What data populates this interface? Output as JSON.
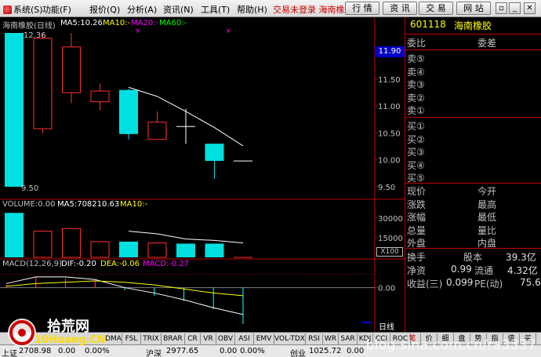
{
  "menu": {
    "items": [
      {
        "label": "系统(S)"
      },
      {
        "label": "功能(F)"
      },
      {
        "label": "报价(Q)"
      },
      {
        "label": "分析(A)"
      },
      {
        "label": "资讯(N)"
      },
      {
        "label": "工具(T)"
      },
      {
        "label": "帮助(H)"
      }
    ],
    "notice": "交易未登录  海南橡胶",
    "buttons": [
      {
        "label": "行 情"
      },
      {
        "label": "资 讯"
      },
      {
        "label": "交 易"
      },
      {
        "label": "网 站"
      }
    ],
    "win_controls": [
      "▫",
      "_",
      "✕"
    ]
  },
  "kline": {
    "stock_name": "海南橡胶(日线)",
    "ma5": "MA5:10.26",
    "ma10": "MA10:-",
    "ma20": "MA20:-",
    "ma60": "MA60:-",
    "high_label": "12.36",
    "low_label": "9.50",
    "current_price_badge": "11.90",
    "y_ticks": [
      "11.50",
      "11.00",
      "10.50",
      "10.00",
      "9.50"
    ]
  },
  "volume": {
    "header": "VOLUME:0.00",
    "ma5": "MA5:708210.63",
    "ma10": "MA10:-",
    "y_ticks": [
      "30000",
      "15000"
    ],
    "unit": "X100"
  },
  "macd": {
    "header": "MACD(12,26,9)",
    "dif": "DIF:-0.20",
    "dea": "DEA:-0.06",
    "macd": "MACD:-0.27",
    "y_ticks": [
      "0.00"
    ],
    "period": "日线"
  },
  "quote_panel": {
    "code": "601118",
    "name": "海南橡胶",
    "weibi": "委比",
    "weicha": "委差",
    "sells": [
      "卖⑤",
      "卖④",
      "卖③",
      "卖②",
      "卖①"
    ],
    "buys": [
      "买①",
      "买②",
      "买③",
      "买④",
      "买⑤"
    ],
    "stats_left": [
      "现价",
      "涨跌",
      "涨幅",
      "总量",
      "外盘"
    ],
    "stats_right": [
      "今开",
      "最高",
      "最低",
      "量比",
      "内盘"
    ],
    "turnover_label": "换手",
    "capital_label": "股本",
    "capital_value": "39.3亿",
    "net_asset_label": "净资",
    "net_asset_value": "0.99",
    "float_label": "流通",
    "float_value": "4.32亿",
    "eps_label": "收益(三)",
    "eps_value": "0.099",
    "pe_label": "PE(动)",
    "pe_value": "75.6"
  },
  "indicator_tabs": [
    "DMA",
    "FSL",
    "TRIX",
    "BRAR",
    "CR",
    "VR",
    "OBV",
    "ASI",
    "EMV",
    "VOL-TDX",
    "RSI",
    "WR",
    "SAR",
    "KDJ",
    "CCI",
    "ROC"
  ],
  "side_tabs": [
    "笔",
    "价",
    "细",
    "盘",
    "势",
    "指",
    "值",
    "买"
  ],
  "status": {
    "sh_label": "上证",
    "sh_value": "2708.98",
    "sh_change": "0.00",
    "sh_pct": "0.00%",
    "hs_label": "沪深",
    "hs_value": "2977.65",
    "hs_change": "0.00",
    "hs_pct": "0.00%",
    "cy_label": "创业",
    "cy_value": "1025.72",
    "cy_change": "0.00"
  },
  "watermark": {
    "brand_cn": "拾荒网",
    "brand_en": "10Huang.CN",
    "url": "blog.sina.com.cn/ra3337"
  },
  "chart_data": {
    "type": "candlestick",
    "y_range": [
      9.5,
      12.36
    ],
    "candles": [
      {
        "open": 12.36,
        "close": 9.5,
        "high": 12.36,
        "low": 9.5
      },
      {
        "open": 10.58,
        "close": 12.26,
        "high": 12.36,
        "low": 10.5
      },
      {
        "open": 11.25,
        "close": 12.1,
        "high": 12.36,
        "low": 11.05
      },
      {
        "open": 11.08,
        "close": 11.28,
        "high": 11.42,
        "low": 10.92
      },
      {
        "open": 11.3,
        "close": 10.48,
        "high": 11.32,
        "low": 10.38
      },
      {
        "open": 10.38,
        "close": 10.7,
        "high": 10.9,
        "low": 10.38
      },
      {
        "open": 10.62,
        "close": 10.62,
        "high": 10.95,
        "low": 10.3
      },
      {
        "open": 10.3,
        "close": 9.98,
        "high": 10.3,
        "low": 9.65
      },
      {
        "open": 9.98,
        "close": 9.98,
        "high": 9.98,
        "low": 9.98
      }
    ],
    "ma5": [
      null,
      null,
      null,
      null,
      11.35,
      11.18,
      10.9,
      10.6,
      10.26
    ],
    "volumes": [
      34000,
      20000,
      22000,
      12000,
      12000,
      11000,
      10500,
      10500,
      0
    ],
    "vol_ma5": [
      null,
      null,
      null,
      null,
      20000,
      18000,
      14000,
      13000,
      11000
    ],
    "macd_hist": [
      0.02,
      0.08,
      0.07,
      0.05,
      -0.02,
      -0.06,
      -0.1,
      -0.16,
      -0.27
    ],
    "dif": [
      0.03,
      0.08,
      0.08,
      0.06,
      0.0,
      -0.04,
      -0.09,
      -0.15,
      -0.2
    ],
    "dea": [
      0.01,
      0.03,
      0.04,
      0.05,
      0.04,
      0.02,
      -0.01,
      -0.04,
      -0.06
    ],
    "colors": {
      "up": "#ff3030",
      "down": "#00e0e0",
      "ma5": "#ffffff",
      "ma10": "#ffff00",
      "ma20": "#ff00ff",
      "ma60": "#00ff00"
    }
  }
}
